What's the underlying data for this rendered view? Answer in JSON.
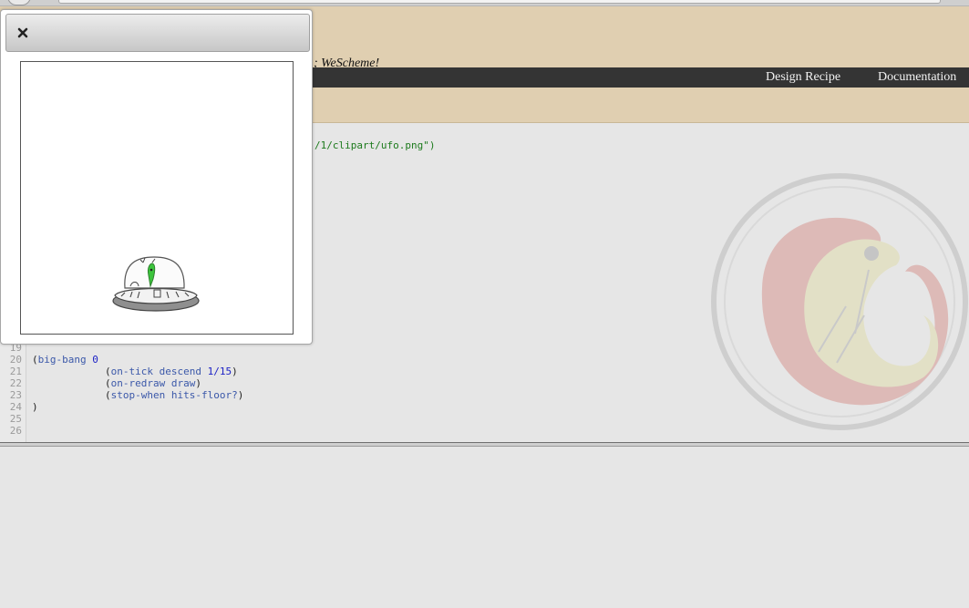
{
  "header": {
    "tagline": "; WeScheme!"
  },
  "nav": {
    "items": [
      {
        "label": "Design Recipe"
      },
      {
        "label": "Documentation"
      }
    ]
  },
  "editor": {
    "partial_line_text": "/1/clipart/ufo.png\")",
    "lines": [
      {
        "num": "19"
      },
      {
        "num": "20"
      },
      {
        "num": "21"
      },
      {
        "num": "22"
      },
      {
        "num": "23"
      },
      {
        "num": "24"
      },
      {
        "num": "25"
      },
      {
        "num": "26"
      }
    ],
    "code": {
      "l20_open": "(",
      "l20_kw": "big-bang",
      "l20_num": "0",
      "l21_open": "(",
      "l21_kw": "on-tick descend",
      "l21_num": "1/15",
      "l21_close": ")",
      "l22_open": "(",
      "l22_kw": "on-redraw draw",
      "l22_close": ")",
      "l23_open": "(",
      "l23_kw": "stop-when hits-floor?",
      "l23_close": ")",
      "l24": ")"
    }
  },
  "dialog": {
    "close_icon": "close-icon",
    "image": "ufo-icon"
  },
  "colors": {
    "header_bg": "#e0cfb1",
    "nav_bg": "#343434",
    "editor_bg": "#e6e6e6",
    "keyword": "#3b58a9",
    "number": "#1d22c6",
    "string": "#1c7a1c"
  }
}
